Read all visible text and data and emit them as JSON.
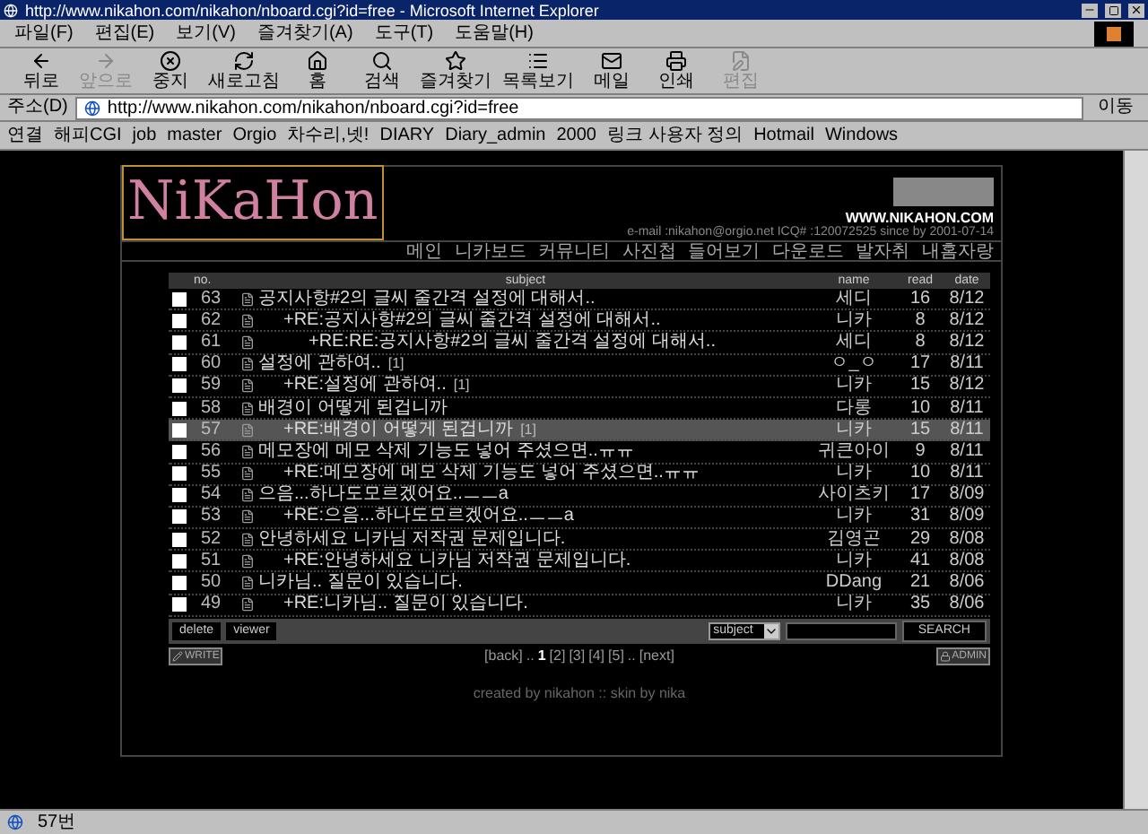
{
  "window": {
    "title": "http://www.nikahon.com/nikahon/nboard.cgi?id=free - Microsoft Internet Explorer"
  },
  "menu": [
    "파일(F)",
    "편집(E)",
    "보기(V)",
    "즐겨찾기(A)",
    "도구(T)",
    "도움말(H)"
  ],
  "toolbar": [
    {
      "label": "뒤로",
      "kind": "back",
      "disabled": false
    },
    {
      "label": "앞으로",
      "kind": "forward",
      "disabled": true
    },
    {
      "label": "중지",
      "kind": "stop",
      "disabled": false
    },
    {
      "label": "새로고침",
      "kind": "refresh",
      "disabled": false
    },
    {
      "label": "홈",
      "kind": "home",
      "disabled": false
    },
    {
      "label": "검색",
      "kind": "search",
      "disabled": false
    },
    {
      "label": "즐겨찾기",
      "kind": "favorites",
      "disabled": false
    },
    {
      "label": "목록보기",
      "kind": "history",
      "disabled": false
    },
    {
      "label": "메일",
      "kind": "mail",
      "disabled": false
    },
    {
      "label": "인쇄",
      "kind": "print",
      "disabled": false
    },
    {
      "label": "편집",
      "kind": "edit",
      "disabled": true
    }
  ],
  "address": {
    "label": "주소(D)",
    "value": "http://www.nikahon.com/nikahon/nboard.cgi?id=free",
    "go": "이동"
  },
  "links": {
    "label": "연결",
    "items": [
      "해피CGI",
      "job",
      "master",
      "Orgio",
      "차수리,넷!",
      "DIARY",
      "Diary_admin",
      "2000",
      "링크 사용자 정의",
      "Hotmail",
      "Windows"
    ]
  },
  "site": {
    "logo": "NiKaHon",
    "domain": "WWW.NIKAHON.COM",
    "contact": "e-mail :nikahon@orgio.net ICQ# :120072525 since by 2001-07-14",
    "nav": [
      "메인",
      "니카보드",
      "커뮤니티",
      "사진첩",
      "들어보기",
      "다운로드",
      "발자취",
      "내홈자랑"
    ]
  },
  "board": {
    "columns": [
      "no.",
      "subject",
      "name",
      "read",
      "date"
    ],
    "rows": [
      {
        "no": "63",
        "subject": "공지사항#2의 글씨 줄간격 설정에 대해서..",
        "name": "세디",
        "read": "16",
        "date": "8/12",
        "selected": false,
        "checked": false,
        "children": [
          {
            "no": "62",
            "subject": "+RE:공지사항#2의 글씨 줄간격 설정에 대해서..",
            "name": "니카",
            "read": "8",
            "date": "8/12",
            "selected": false,
            "checked": false,
            "children": [
              {
                "no": "61",
                "subject": "+RE:RE:공지사항#2의 글씨 줄간격 설정에 대해서..",
                "name": "세디",
                "read": "8",
                "date": "8/12",
                "selected": false,
                "checked": false
              }
            ]
          }
        ]
      },
      {
        "no": "60",
        "subject": "설정에 관하여..",
        "comments": "[1]",
        "name": "ㅇ_ㅇ",
        "read": "17",
        "date": "8/11",
        "selected": false,
        "checked": false,
        "children": [
          {
            "no": "59",
            "subject": "+RE:설정에 관하여..",
            "comments": "[1]",
            "name": "니카",
            "read": "15",
            "date": "8/12",
            "selected": false,
            "checked": false
          }
        ]
      },
      {
        "no": "58",
        "subject": "배경이 어떻게 된겁니까",
        "name": "다롱",
        "read": "10",
        "date": "8/11",
        "selected": false,
        "checked": false,
        "children": [
          {
            "no": "57",
            "subject": "+RE:배경이 어떻게 된겁니까",
            "comments": "[1]",
            "name": "니카",
            "read": "15",
            "date": "8/11",
            "selected": true,
            "checked": false
          }
        ]
      },
      {
        "no": "56",
        "subject": "메모장에 메모 삭제 기능도 넣어 주셨으면..ㅠㅠ",
        "name": "귀큰아이",
        "read": "9",
        "date": "8/11",
        "selected": false,
        "checked": false,
        "children": [
          {
            "no": "55",
            "subject": "+RE:메모장에 메모 삭제 기능도 넣어 주셨으면..ㅠㅠ",
            "name": "니카",
            "read": "10",
            "date": "8/11",
            "selected": false,
            "checked": false
          }
        ]
      },
      {
        "no": "54",
        "subject": "으음...하나도모르겠어요..ㅡㅡa",
        "name": "사이츠키",
        "read": "17",
        "date": "8/09",
        "selected": false,
        "checked": false,
        "children": [
          {
            "no": "53",
            "subject": "+RE:으음...하나도모르겠어요..ㅡㅡa",
            "name": "니카",
            "read": "31",
            "date": "8/09",
            "selected": false,
            "checked": false
          }
        ]
      },
      {
        "no": "52",
        "subject": "안녕하세요 니카님 저작권 문제입니다.",
        "name": "김영곤",
        "read": "29",
        "date": "8/08",
        "selected": false,
        "checked": false,
        "children": [
          {
            "no": "51",
            "subject": "+RE:안녕하세요 니카님 저작권 문제입니다.",
            "name": "니카",
            "read": "41",
            "date": "8/08",
            "selected": false,
            "checked": false
          }
        ]
      },
      {
        "no": "50",
        "subject": "니카님.. 질문이 있습니다.",
        "name": "DDang",
        "read": "21",
        "date": "8/06",
        "selected": false,
        "checked": false,
        "children": [
          {
            "no": "49",
            "subject": "+RE:니카님.. 질문이 있습니다.",
            "name": "니카",
            "read": "35",
            "date": "8/06",
            "selected": false,
            "checked": false
          }
        ]
      }
    ],
    "delete": "delete",
    "viewer": "viewer",
    "search_field": "subject",
    "search_button": "SEARCH",
    "write": "WRITE",
    "admin": "ADMIN",
    "pages": {
      "back": "[back]",
      "sep": "..",
      "items": [
        {
          "label": "1",
          "selected": true
        },
        {
          "label": "[2]",
          "selected": false
        },
        {
          "label": "[3]",
          "selected": false
        },
        {
          "label": "[4]",
          "selected": false
        },
        {
          "label": "[5]",
          "selected": false
        }
      ],
      "next": "[next]"
    },
    "footer": "created by nikahon :: skin by nika"
  },
  "status_bar": {
    "text": "57번"
  }
}
